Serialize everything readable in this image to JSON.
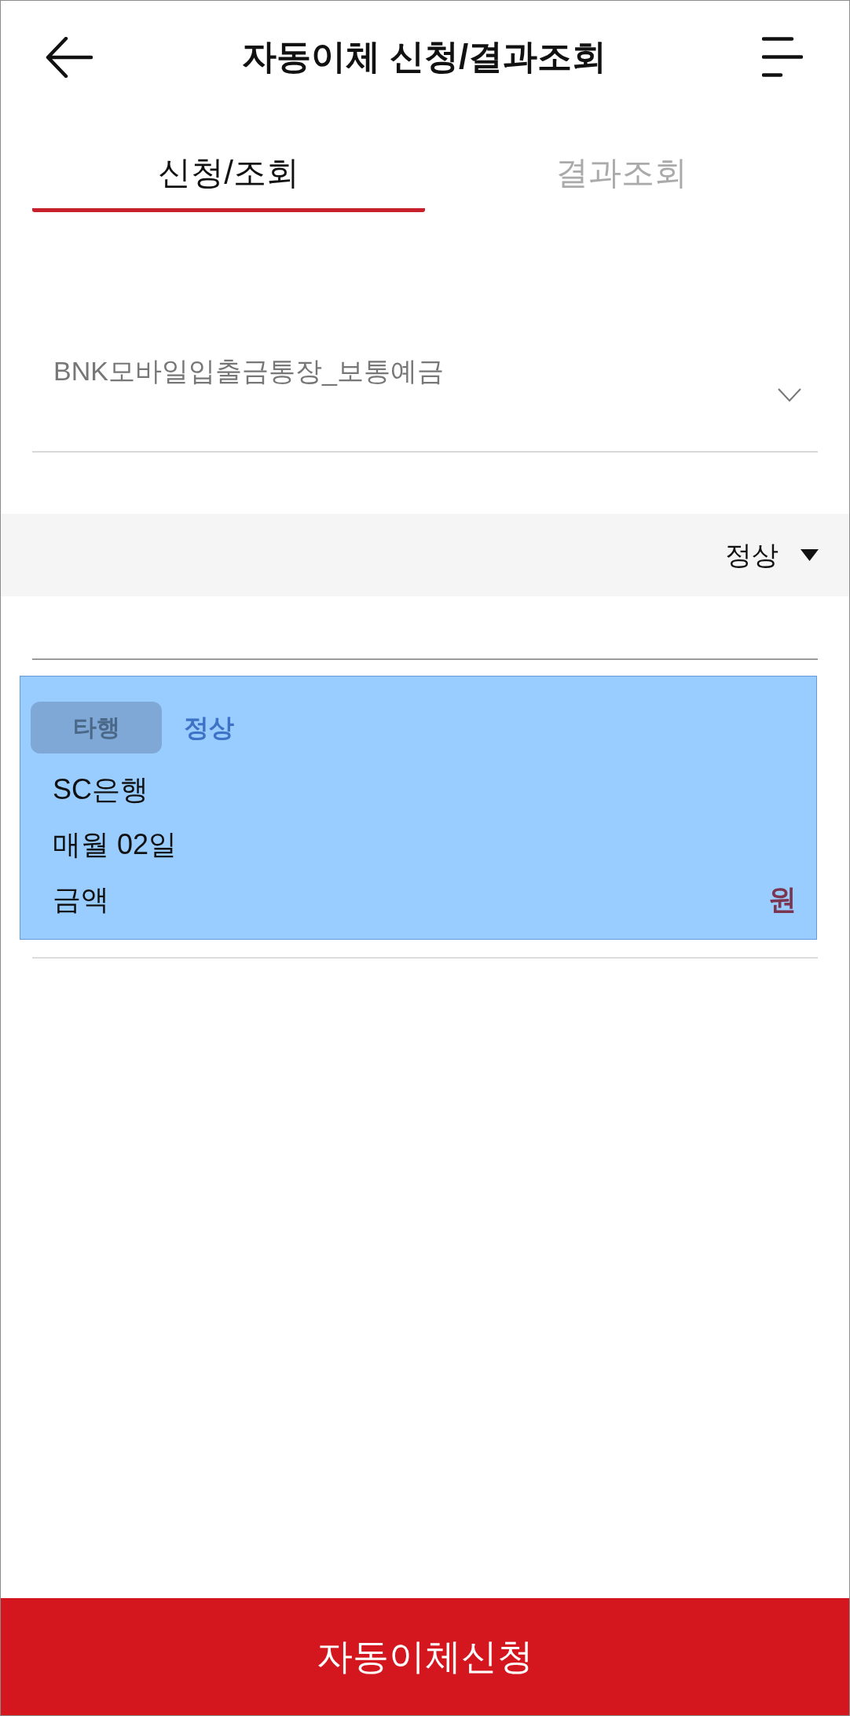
{
  "header": {
    "title": "자동이체 신청/결과조회"
  },
  "tabs": [
    {
      "label": "신청/조회",
      "selected": true
    },
    {
      "label": "결과조회",
      "selected": false
    }
  ],
  "account_select": {
    "value": "BNK모바일입출금통장_보통예금"
  },
  "status_filter": {
    "value": "정상"
  },
  "transfers": [
    {
      "bank_type": "타행",
      "status": "정상",
      "bank": "SC은행",
      "schedule": "매월 02일",
      "amount_label": "금액",
      "amount_unit": "원",
      "selected": true
    }
  ],
  "submit_button": {
    "label": "자동이체신청"
  }
}
